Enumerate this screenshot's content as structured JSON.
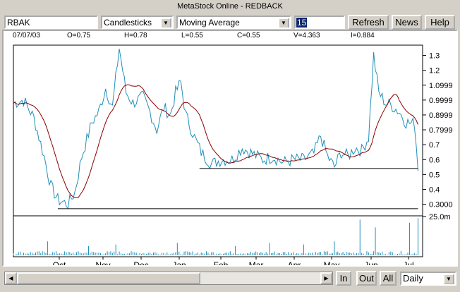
{
  "window": {
    "title": "MetaStock Online - REDBACK"
  },
  "toolbar": {
    "symbol": "RBAK",
    "chart_type": "Candlesticks",
    "indicator": "Moving Average",
    "period": "15",
    "refresh_label": "Refresh",
    "news_label": "News",
    "help_label": "Help"
  },
  "info": {
    "date": "07/07/03",
    "open": "O=0.75",
    "high": "H=0.78",
    "low": "L=0.55",
    "close": "C=0.55",
    "volume": "V=4.363",
    "interest": "I=0.884"
  },
  "bottom": {
    "in_label": "In",
    "out_label": "Out",
    "all_label": "All",
    "period_select": "Daily"
  },
  "chart_data": {
    "type": "line",
    "price_axis_labels": [
      "1.3",
      "1.2",
      "1.0999",
      "0.9999",
      "0.8999",
      "0.7999",
      "0.7",
      "0.6",
      "0.5",
      "0.4",
      "0.3000"
    ],
    "price_axis_values": [
      1.3,
      1.2,
      1.1,
      1.0,
      0.9,
      0.8,
      0.7,
      0.6,
      0.5,
      0.4,
      0.3
    ],
    "volume_axis_label": "25.0m",
    "volume_axis_value": 25,
    "months": [
      "Oct",
      "Nov",
      "Dec",
      "Jan",
      "Feb",
      "Mar",
      "Apr",
      "May",
      "Jun",
      "Jul"
    ],
    "price_key": [
      [
        0,
        0.98
      ],
      [
        6,
        1.0
      ],
      [
        12,
        0.88
      ],
      [
        18,
        0.62
      ],
      [
        22,
        0.42
      ],
      [
        26,
        0.33
      ],
      [
        32,
        0.3
      ],
      [
        36,
        0.38
      ],
      [
        40,
        0.62
      ],
      [
        46,
        0.85
      ],
      [
        50,
        0.92
      ],
      [
        54,
        1.08
      ],
      [
        58,
        0.95
      ],
      [
        62,
        1.35
      ],
      [
        66,
        1.05
      ],
      [
        70,
        0.98
      ],
      [
        76,
        1.02
      ],
      [
        80,
        0.92
      ],
      [
        84,
        0.8
      ],
      [
        88,
        0.95
      ],
      [
        92,
        0.9
      ],
      [
        95,
        1.05
      ],
      [
        98,
        1.12
      ],
      [
        101,
        0.9
      ],
      [
        106,
        0.75
      ],
      [
        110,
        0.65
      ],
      [
        116,
        0.57
      ],
      [
        122,
        0.6
      ],
      [
        128,
        0.6
      ],
      [
        134,
        0.68
      ],
      [
        140,
        0.64
      ],
      [
        146,
        0.6
      ],
      [
        152,
        0.62
      ],
      [
        158,
        0.58
      ],
      [
        164,
        0.6
      ],
      [
        170,
        0.6
      ],
      [
        176,
        0.64
      ],
      [
        180,
        0.76
      ],
      [
        184,
        0.62
      ],
      [
        188,
        0.55
      ],
      [
        192,
        0.65
      ],
      [
        196,
        0.62
      ],
      [
        200,
        0.68
      ],
      [
        204,
        0.66
      ],
      [
        208,
        0.75
      ],
      [
        211,
        1.3
      ],
      [
        214,
        1.05
      ],
      [
        218,
        0.98
      ],
      [
        222,
        0.96
      ],
      [
        226,
        0.92
      ],
      [
        230,
        0.85
      ],
      [
        235,
        0.84
      ],
      [
        237,
        0.55
      ]
    ],
    "support_lines": [
      {
        "from": 26,
        "to": 237,
        "value": 0.27
      },
      {
        "from": 109,
        "to": 237,
        "value": 0.54
      }
    ],
    "volume_spikes": [
      [
        203,
        23
      ],
      [
        212,
        18
      ],
      [
        232,
        21
      ],
      [
        237,
        24
      ],
      [
        188,
        9
      ],
      [
        150,
        8
      ],
      [
        96,
        8
      ],
      [
        60,
        7
      ],
      [
        20,
        9
      ],
      [
        44,
        6
      ],
      [
        130,
        6
      ],
      [
        170,
        7
      ]
    ]
  }
}
